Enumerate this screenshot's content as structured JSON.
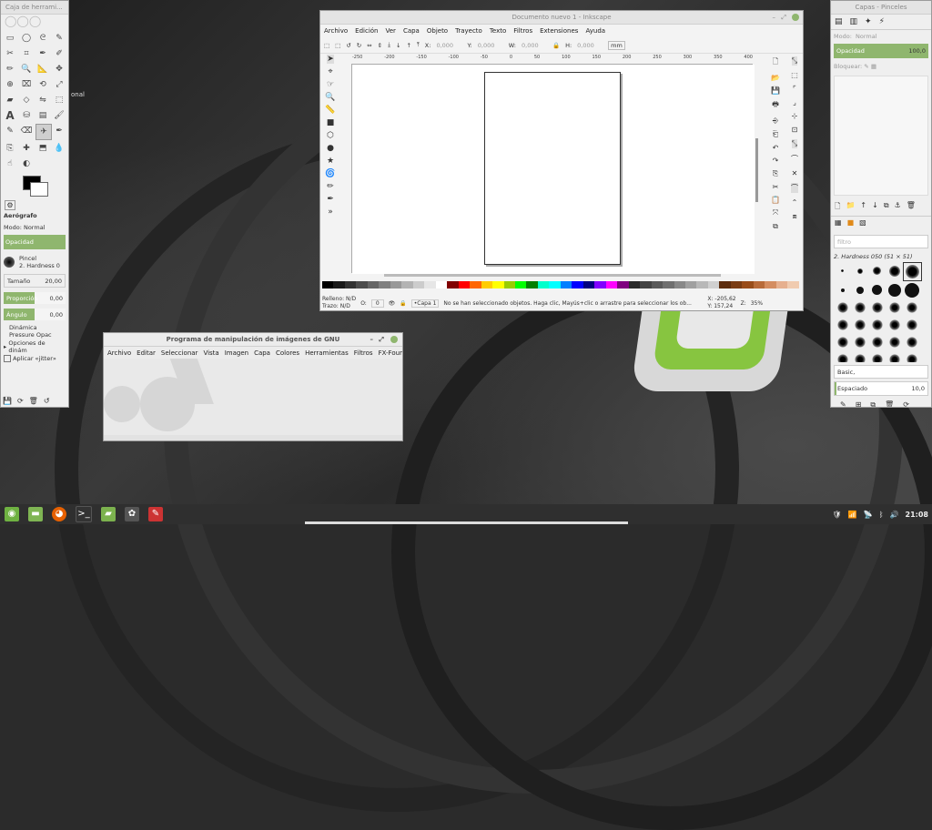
{
  "desktop": {
    "side_text": "onal"
  },
  "toolbox": {
    "title": "Caja de herrami...",
    "tool_options_title": "Aerógrafo",
    "mode_label": "Modo:",
    "mode_value": "Normal",
    "opacity_label": "Opacidad",
    "brush_label": "Pincel",
    "brush_value": "2. Hardness 0",
    "size_label": "Tamaño",
    "size_value": "20,00",
    "ratio_label": "Proporción",
    "ratio_value": "0,00",
    "angle_label": "Ángulo",
    "angle_value": "0,00",
    "dynamics_label": "Dinámica",
    "dynamics_value": "Pressure Opac",
    "dynamics_options": "Opciones de dinám",
    "jitter_label": "Aplicar «jitter»"
  },
  "inkscape": {
    "title": "Documento nuevo 1 - Inkscape",
    "menu": [
      "Archivo",
      "Edición",
      "Ver",
      "Capa",
      "Objeto",
      "Trayecto",
      "Texto",
      "Filtros",
      "Extensiones",
      "Ayuda"
    ],
    "x_label": "X:",
    "x_value": "0,000",
    "y_label": "Y:",
    "y_value": "0,000",
    "w_label": "W:",
    "w_value": "0,000",
    "h_label": "H:",
    "h_value": "0,000",
    "unit": "mm",
    "ruler_labels": [
      "-250",
      "-200",
      "-150",
      "-100",
      "-50",
      "0",
      "50",
      "100",
      "150",
      "200",
      "250",
      "300",
      "350",
      "400"
    ],
    "fill_label": "Relleno:",
    "fill_value": "N/D",
    "stroke_label": "Trazo:",
    "stroke_value": "N/D",
    "opacity_o": "O:",
    "opacity_value": "0",
    "layer": "•Capa 1",
    "status_message": "No se han seleccionado objetos. Haga clic, Mayús+clic o arrastre para seleccionar los ob...",
    "coord_x": "X: -205,62",
    "coord_y": "Y: 157,24",
    "zoom_label": "Z:",
    "zoom_value": "35%",
    "palette": [
      "#000000",
      "#1a1a1a",
      "#333333",
      "#4d4d4d",
      "#666666",
      "#808080",
      "#999999",
      "#b3b3b3",
      "#cccccc",
      "#e6e6e6",
      "#ffffff",
      "#800000",
      "#ff0000",
      "#ff6600",
      "#ffcc00",
      "#ffff00",
      "#99cc00",
      "#00ff00",
      "#008000",
      "#00ffcc",
      "#00ffff",
      "#0080ff",
      "#0000ff",
      "#000080",
      "#8000ff",
      "#ff00ff",
      "#800080",
      "#2b2b2b",
      "#444444",
      "#5a5a5a",
      "#707070",
      "#888888",
      "#a0a0a0",
      "#b8b8b8",
      "#d0d0d0",
      "#5c2d0e",
      "#7a3d14",
      "#994d1a",
      "#b86b3a",
      "#d48d61",
      "#e6b08f",
      "#f0cbb0"
    ]
  },
  "gimp_main": {
    "title": "Programa de manipulación de imágenes de GNU",
    "menu": [
      "Archivo",
      "Editar",
      "Seleccionar",
      "Vista",
      "Imagen",
      "Capa",
      "Colores",
      "Herramientas",
      "Filtros",
      "FX-Foundry"
    ]
  },
  "layers": {
    "title": "Capas - Pinceles",
    "mode_label": "Modo:",
    "mode_value": "Normal",
    "opacity_label": "Opacidad",
    "opacity_value": "100,0",
    "lock_label": "Bloquear:",
    "filter_placeholder": "filtro",
    "brush_name": "2. Hardness 050 (51 × 51)",
    "tag_value": "Basic,",
    "spacing_label": "Espaciado",
    "spacing_value": "10,0"
  },
  "taskbar": {
    "clock": "21:08"
  }
}
